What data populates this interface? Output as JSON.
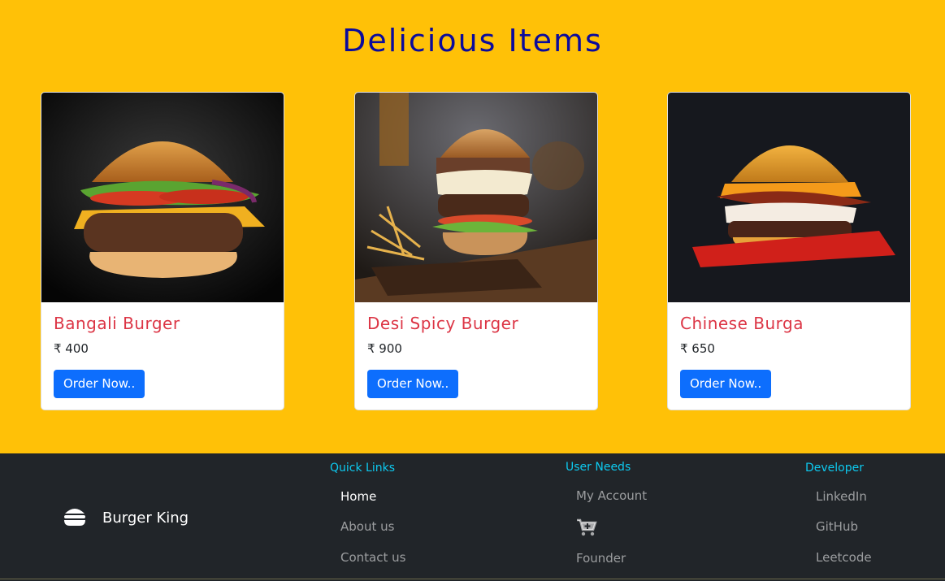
{
  "section": {
    "heading": "Delicious Items"
  },
  "cards": [
    {
      "title": "Bangali Burger",
      "price": "₹ 400",
      "button": "Order Now.."
    },
    {
      "title": "Desi Spicy Burger",
      "price": "₹ 900",
      "button": "Order Now.."
    },
    {
      "title": "Chinese Burga",
      "price": "₹ 650",
      "button": "Order Now.."
    }
  ],
  "footer": {
    "brand": "Burger King",
    "quick_links": {
      "title": "Quick Links",
      "items": [
        "Home",
        "About us",
        "Contact us"
      ]
    },
    "user_needs": {
      "title": "User Needs",
      "items": [
        "My Account",
        "Founder"
      ]
    },
    "developer": {
      "title": "Developer",
      "items": [
        "LinkedIn",
        "GitHub",
        "Leetcode"
      ]
    }
  },
  "colors": {
    "background": "#ffc107",
    "heading": "#0b0b9c",
    "card_title": "#dc3545",
    "button": "#0d6efd",
    "footer_bg": "#212529",
    "footer_title": "#0dcaf0"
  },
  "icons": {
    "brand": "burger-icon",
    "cart": "cart-plus-icon"
  }
}
